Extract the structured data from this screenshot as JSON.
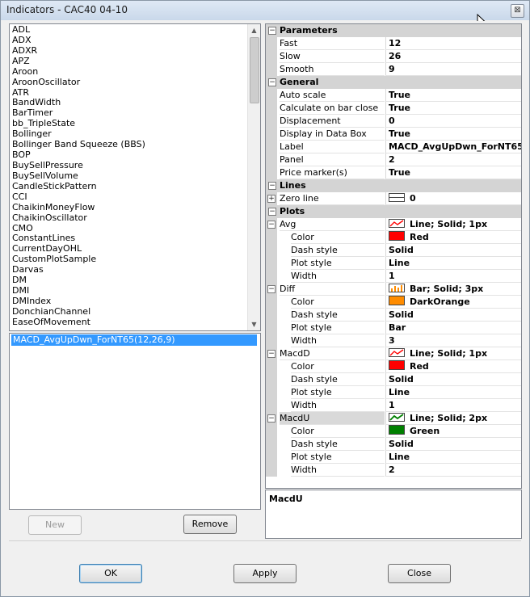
{
  "window": {
    "title": "Indicators - CAC40 04-10",
    "close_glyph": "⊠"
  },
  "indicators": [
    "ADL",
    "ADX",
    "ADXR",
    "APZ",
    "Aroon",
    "AroonOscillator",
    "ATR",
    "BandWidth",
    "BarTimer",
    "bb_TripleState",
    "Bollinger",
    "Bollinger Band Squeeze (BBS)",
    "BOP",
    "BuySellPressure",
    "BuySellVolume",
    "CandleStickPattern",
    "CCI",
    "ChaikinMoneyFlow",
    "ChaikinOscillator",
    "CMO",
    "ConstantLines",
    "CurrentDayOHL",
    "CustomPlotSample",
    "Darvas",
    "DM",
    "DMI",
    "DMIndex",
    "DonchianChannel",
    "EaseOfMovement"
  ],
  "selected_indicator": "MACD_AvgUpDwn_ForNT65(12,26,9)",
  "buttons": {
    "new": "New",
    "remove": "Remove",
    "ok": "OK",
    "apply": "Apply",
    "close": "Close"
  },
  "grid": {
    "parameters": {
      "label": "Parameters",
      "fast_k": "Fast",
      "fast_v": "12",
      "slow_k": "Slow",
      "slow_v": "26",
      "smooth_k": "Smooth",
      "smooth_v": "9"
    },
    "general": {
      "label": "General",
      "auto_k": "Auto scale",
      "auto_v": "True",
      "calc_k": "Calculate on bar close",
      "calc_v": "True",
      "disp_k": "Displacement",
      "disp_v": "0",
      "databox_k": "Display in Data Box",
      "databox_v": "True",
      "label_k": "Label",
      "label_v": "MACD_AvgUpDwn_ForNT65",
      "panel_k": "Panel",
      "panel_v": "2",
      "marker_k": "Price marker(s)",
      "marker_v": "True"
    },
    "lines": {
      "label": "Lines",
      "zero_k": "Zero line",
      "zero_v": "0"
    },
    "plots": {
      "label": "Plots",
      "avg": {
        "name": "Avg",
        "summary": "Line; Solid; 1px",
        "color_k": "Color",
        "color_v": "Red",
        "dash_k": "Dash style",
        "dash_v": "Solid",
        "plot_k": "Plot style",
        "plot_v": "Line",
        "width_k": "Width",
        "width_v": "1"
      },
      "diff": {
        "name": "Diff",
        "summary": "Bar; Solid; 3px",
        "color_k": "Color",
        "color_v": "DarkOrange",
        "dash_k": "Dash style",
        "dash_v": "Solid",
        "plot_k": "Plot style",
        "plot_v": "Bar",
        "width_k": "Width",
        "width_v": "3"
      },
      "macdd": {
        "name": "MacdD",
        "summary": "Line; Solid; 1px",
        "color_k": "Color",
        "color_v": "Red",
        "dash_k": "Dash style",
        "dash_v": "Solid",
        "plot_k": "Plot style",
        "plot_v": "Line",
        "width_k": "Width",
        "width_v": "1"
      },
      "macdu": {
        "name": "MacdU",
        "summary": "Line; Solid; 2px",
        "color_k": "Color",
        "color_v": "Green",
        "dash_k": "Dash style",
        "dash_v": "Solid",
        "plot_k": "Plot style",
        "plot_v": "Line",
        "width_k": "Width",
        "width_v": "2"
      }
    }
  },
  "description": {
    "title": "MacdU"
  },
  "colors": {
    "red": "#ff0000",
    "darkorange": "#ff8c00",
    "green": "#008000",
    "selection": "#3399ff"
  }
}
